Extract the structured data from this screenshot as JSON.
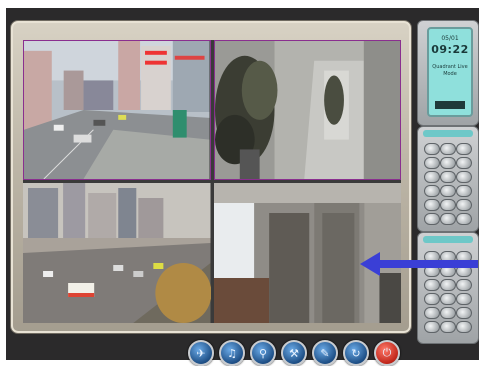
{
  "lcd": {
    "date": "05/01",
    "time": "09:22",
    "mode": "Quadrant Live Mode"
  },
  "colors": {
    "frame": "#b9b2a3",
    "app_background": "#2b2a2b",
    "accent_arrow": "#3a3fd6",
    "camera_border": "#8a2f8f"
  },
  "cameras": [
    {
      "name": "camera-1",
      "scene": "city street intersection"
    },
    {
      "name": "camera-2",
      "scene": "office corridor with plants"
    },
    {
      "name": "camera-3",
      "scene": "traffic highway"
    },
    {
      "name": "camera-4",
      "scene": "office interior"
    }
  ],
  "toolbar": [
    {
      "icon": "run-icon"
    },
    {
      "icon": "speaker-icon"
    },
    {
      "icon": "search-icon"
    },
    {
      "icon": "hammer-icon"
    },
    {
      "icon": "mic-icon"
    },
    {
      "icon": "refresh-icon"
    },
    {
      "icon": "power-icon"
    }
  ]
}
